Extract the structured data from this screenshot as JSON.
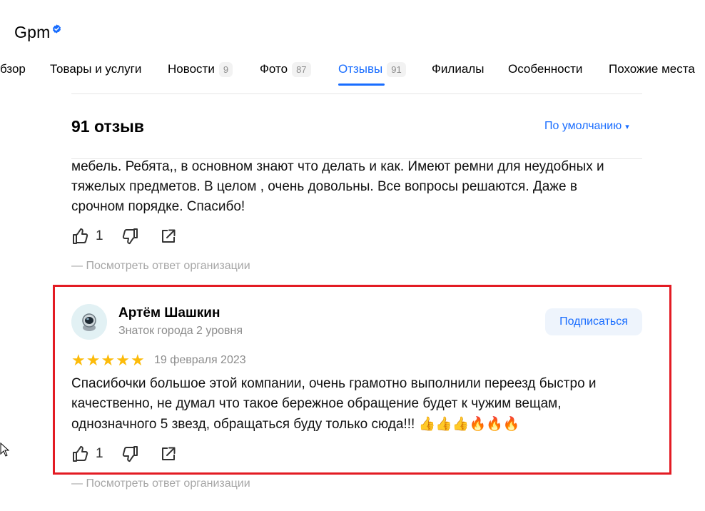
{
  "org": {
    "name": "Gpm",
    "verified_icon": "verified-check-icon",
    "accent": "#196dff"
  },
  "tabs": [
    {
      "label": "бзор"
    },
    {
      "label": "Товары и услуги"
    },
    {
      "label": "Новости",
      "count": "9"
    },
    {
      "label": "Фото",
      "count": "87"
    },
    {
      "label": "Отзывы",
      "count": "91",
      "active": true
    },
    {
      "label": "Филиалы"
    },
    {
      "label": "Особенности"
    },
    {
      "label": "Похожие места"
    }
  ],
  "reviews": {
    "count_label": "91 отзыв",
    "sort_label": "По умолчанию",
    "sort_arrow": "▾",
    "org_reply_label": "— Посмотреть ответ организации",
    "items": [
      {
        "text_lines": [
          "мебель. Ребята,, в основном знают что делать и как. Имеют ремни для неудобных и",
          "тяжелых предметов. В целом , очень довольны. Все вопросы решаются. Даже в",
          "срочном порядке. Спасибо!"
        ],
        "likes": "1"
      },
      {
        "author": "Артём Шашкин",
        "level": "Знаток города 2 уровня",
        "subscribe_label": "Подписаться",
        "rating": 5,
        "date": "19 февраля 2023",
        "text_lines": [
          "Спасибочки большое этой компании, очень грамотно выполнили переезд быстро и",
          "качественно, не думал что такое бережное обращение будет к чужим вещам,",
          "однозначного 5 звезд, обращаться буду только сюда!!! "
        ],
        "text_emoji": "👍👍👍🔥🔥🔥",
        "likes": "1"
      }
    ]
  },
  "colors": {
    "star": "#fcbb0a",
    "highlight_border": "#e31b23",
    "link": "#196dff"
  }
}
